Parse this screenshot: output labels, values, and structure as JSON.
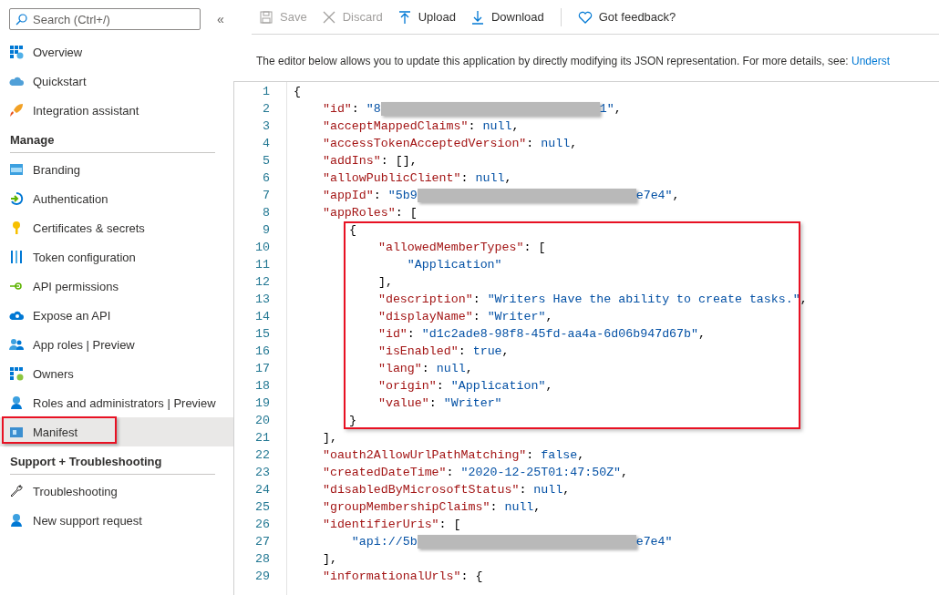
{
  "sidebar": {
    "search": {
      "placeholder": "Search (Ctrl+/)"
    },
    "collapse": "«",
    "groups": [
      {
        "items": [
          {
            "label": "Overview",
            "selected": false,
            "annotated": false
          },
          {
            "label": "Quickstart",
            "selected": false,
            "annotated": false
          },
          {
            "label": "Integration assistant",
            "selected": false,
            "annotated": false
          }
        ]
      },
      {
        "heading": "Manage",
        "items": [
          {
            "label": "Branding",
            "selected": false,
            "annotated": false
          },
          {
            "label": "Authentication",
            "selected": false,
            "annotated": false
          },
          {
            "label": "Certificates & secrets",
            "selected": false,
            "annotated": false
          },
          {
            "label": "Token configuration",
            "selected": false,
            "annotated": false
          },
          {
            "label": "API permissions",
            "selected": false,
            "annotated": false
          },
          {
            "label": "Expose an API",
            "selected": false,
            "annotated": false
          },
          {
            "label": "App roles | Preview",
            "selected": false,
            "annotated": false
          },
          {
            "label": "Owners",
            "selected": false,
            "annotated": false
          },
          {
            "label": "Roles and administrators | Preview",
            "selected": false,
            "annotated": false
          },
          {
            "label": "Manifest",
            "selected": true,
            "annotated": true
          }
        ]
      },
      {
        "heading": "Support + Troubleshooting",
        "items": [
          {
            "label": "Troubleshooting",
            "selected": false,
            "annotated": false
          },
          {
            "label": "New support request",
            "selected": false,
            "annotated": false
          }
        ]
      }
    ]
  },
  "toolbar": [
    {
      "label": "Save",
      "disabled": true
    },
    {
      "label": "Discard",
      "disabled": true
    },
    {
      "label": "Upload",
      "disabled": false
    },
    {
      "label": "Download",
      "disabled": false
    },
    {
      "label": "Got feedback?",
      "disabled": false
    }
  ],
  "description": {
    "text": "The editor below allows you to update this application by directly modifying its JSON representation. For more details, see:",
    "link": "Underst"
  },
  "editor": {
    "blocks": [
      {
        "annotated": false,
        "lines": [
          {
            "n": "1",
            "tokens": [
              {
                "kind": "punct",
                "text": "{"
              }
            ]
          },
          {
            "n": "2",
            "tokens": [
              {
                "kind": "key",
                "text": "    \"id\""
              },
              {
                "kind": "punct",
                "text": ": "
              },
              {
                "kind": "str",
                "text": "\"8"
              },
              {
                "kind": "redacted"
              },
              {
                "kind": "str",
                "text": "1\""
              },
              {
                "kind": "punct",
                "text": ","
              }
            ]
          },
          {
            "n": "3",
            "tokens": [
              {
                "kind": "key",
                "text": "    \"acceptMappedClaims\""
              },
              {
                "kind": "punct",
                "text": ": "
              },
              {
                "kind": "lit",
                "text": "null"
              },
              {
                "kind": "punct",
                "text": ","
              }
            ]
          },
          {
            "n": "4",
            "tokens": [
              {
                "kind": "key",
                "text": "    \"accessTokenAcceptedVersion\""
              },
              {
                "kind": "punct",
                "text": ": "
              },
              {
                "kind": "lit",
                "text": "null"
              },
              {
                "kind": "punct",
                "text": ","
              }
            ]
          },
          {
            "n": "5",
            "tokens": [
              {
                "kind": "key",
                "text": "    \"addIns\""
              },
              {
                "kind": "punct",
                "text": ": [],"
              }
            ]
          },
          {
            "n": "6",
            "tokens": [
              {
                "kind": "key",
                "text": "    \"allowPublicClient\""
              },
              {
                "kind": "punct",
                "text": ": "
              },
              {
                "kind": "lit",
                "text": "null"
              },
              {
                "kind": "punct",
                "text": ","
              }
            ]
          },
          {
            "n": "7",
            "tokens": [
              {
                "kind": "key",
                "text": "    \"appId\""
              },
              {
                "kind": "punct",
                "text": ": "
              },
              {
                "kind": "str",
                "text": "\"5b9"
              },
              {
                "kind": "redacted"
              },
              {
                "kind": "str",
                "text": "e7e4\""
              },
              {
                "kind": "punct",
                "text": ","
              }
            ]
          },
          {
            "n": "8",
            "tokens": [
              {
                "kind": "key",
                "text": "    \"appRoles\""
              },
              {
                "kind": "punct",
                "text": ": ["
              }
            ]
          }
        ]
      },
      {
        "annotated": true,
        "lines": [
          {
            "n": "9",
            "tokens": [
              {
                "kind": "punct",
                "text": "{"
              }
            ]
          },
          {
            "n": "10",
            "tokens": [
              {
                "kind": "key",
                "text": "    \"allowedMemberTypes\""
              },
              {
                "kind": "punct",
                "text": ": ["
              }
            ]
          },
          {
            "n": "11",
            "tokens": [
              {
                "kind": "str",
                "text": "        \"Application\""
              }
            ]
          },
          {
            "n": "12",
            "tokens": [
              {
                "kind": "punct",
                "text": "    ],"
              }
            ]
          },
          {
            "n": "13",
            "tokens": [
              {
                "kind": "key",
                "text": "    \"description\""
              },
              {
                "kind": "punct",
                "text": ": "
              },
              {
                "kind": "str",
                "text": "\"Writers Have the ability to create tasks.\""
              },
              {
                "kind": "punct",
                "text": ","
              }
            ]
          },
          {
            "n": "14",
            "tokens": [
              {
                "kind": "key",
                "text": "    \"displayName\""
              },
              {
                "kind": "punct",
                "text": ": "
              },
              {
                "kind": "str",
                "text": "\"Writer\""
              },
              {
                "kind": "punct",
                "text": ","
              }
            ]
          },
          {
            "n": "15",
            "tokens": [
              {
                "kind": "key",
                "text": "    \"id\""
              },
              {
                "kind": "punct",
                "text": ": "
              },
              {
                "kind": "str",
                "text": "\"d1c2ade8-98f8-45fd-aa4a-6d06b947d67b\""
              },
              {
                "kind": "punct",
                "text": ","
              }
            ]
          },
          {
            "n": "16",
            "tokens": [
              {
                "kind": "key",
                "text": "    \"isEnabled\""
              },
              {
                "kind": "punct",
                "text": ": "
              },
              {
                "kind": "lit",
                "text": "true"
              },
              {
                "kind": "punct",
                "text": ","
              }
            ]
          },
          {
            "n": "17",
            "tokens": [
              {
                "kind": "key",
                "text": "    \"lang\""
              },
              {
                "kind": "punct",
                "text": ": "
              },
              {
                "kind": "lit",
                "text": "null"
              },
              {
                "kind": "punct",
                "text": ","
              }
            ]
          },
          {
            "n": "18",
            "tokens": [
              {
                "kind": "key",
                "text": "    \"origin\""
              },
              {
                "kind": "punct",
                "text": ": "
              },
              {
                "kind": "str",
                "text": "\"Application\""
              },
              {
                "kind": "punct",
                "text": ","
              }
            ]
          },
          {
            "n": "19",
            "tokens": [
              {
                "kind": "key",
                "text": "    \"value\""
              },
              {
                "kind": "punct",
                "text": ": "
              },
              {
                "kind": "str",
                "text": "\"Writer\""
              }
            ]
          },
          {
            "n": "20",
            "tokens": [
              {
                "kind": "punct",
                "text": "}"
              }
            ]
          }
        ]
      },
      {
        "annotated": false,
        "lines": [
          {
            "n": "21",
            "tokens": [
              {
                "kind": "punct",
                "text": "    ],"
              }
            ]
          },
          {
            "n": "22",
            "tokens": [
              {
                "kind": "key",
                "text": "    \"oauth2AllowUrlPathMatching\""
              },
              {
                "kind": "punct",
                "text": ": "
              },
              {
                "kind": "lit",
                "text": "false"
              },
              {
                "kind": "punct",
                "text": ","
              }
            ]
          },
          {
            "n": "23",
            "tokens": [
              {
                "kind": "key",
                "text": "    \"createdDateTime\""
              },
              {
                "kind": "punct",
                "text": ": "
              },
              {
                "kind": "str",
                "text": "\"2020-12-25T01:47:50Z\""
              },
              {
                "kind": "punct",
                "text": ","
              }
            ]
          },
          {
            "n": "24",
            "tokens": [
              {
                "kind": "key",
                "text": "    \"disabledByMicrosoftStatus\""
              },
              {
                "kind": "punct",
                "text": ": "
              },
              {
                "kind": "lit",
                "text": "null"
              },
              {
                "kind": "punct",
                "text": ","
              }
            ]
          },
          {
            "n": "25",
            "tokens": [
              {
                "kind": "key",
                "text": "    \"groupMembershipClaims\""
              },
              {
                "kind": "punct",
                "text": ": "
              },
              {
                "kind": "lit",
                "text": "null"
              },
              {
                "kind": "punct",
                "text": ","
              }
            ]
          },
          {
            "n": "26",
            "tokens": [
              {
                "kind": "key",
                "text": "    \"identifierUris\""
              },
              {
                "kind": "punct",
                "text": ": ["
              }
            ]
          },
          {
            "n": "27",
            "tokens": [
              {
                "kind": "str",
                "text": "        \"api://5b"
              },
              {
                "kind": "redacted"
              },
              {
                "kind": "str",
                "text": "e7e4\""
              }
            ]
          },
          {
            "n": "28",
            "tokens": [
              {
                "kind": "punct",
                "text": "    ],"
              }
            ]
          },
          {
            "n": "29",
            "tokens": [
              {
                "kind": "key",
                "text": "    \"informationalUrls\""
              },
              {
                "kind": "punct",
                "text": ": {"
              }
            ]
          }
        ]
      }
    ]
  }
}
